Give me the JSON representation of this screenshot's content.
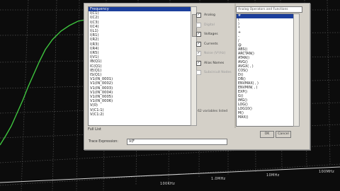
{
  "plot": {
    "x_tick_labels": [
      "100KHz",
      "1.0MHz",
      "10MHz",
      "100MHz"
    ],
    "trace_color": "#3ec43e",
    "grid_color": "#4a4a4a"
  },
  "dialog": {
    "variables_header": "Frequency",
    "variables": [
      "I(C1)",
      "I(C2)",
      "I(C3)",
      "I(C4)",
      "I(L1)",
      "I(R1)",
      "I(R2)",
      "I(R3)",
      "I(R4)",
      "I(R5)",
      "I(V1)",
      "IB(Q1)",
      "IC(Q1)",
      "IE(Q1)",
      "IS(Q1)",
      "V1(IN_0001)",
      "V1(IN_0002)",
      "V1(IN_0003)",
      "V1(IN_0004)",
      "V1(IN_0005)",
      "V1(IN_0006)",
      "V(0)",
      "V(C1:1)",
      "V(C1:2)"
    ],
    "filters": [
      {
        "label": "Analog",
        "checked": true,
        "enabled": true
      },
      {
        "label": "Digital",
        "checked": false,
        "enabled": false
      },
      {
        "label": "Voltages",
        "checked": true,
        "enabled": true
      },
      {
        "label": "Currents",
        "checked": true,
        "enabled": true
      },
      {
        "label": "Noise (V²/Hz)",
        "checked": true,
        "enabled": false
      },
      {
        "label": "Alias Names",
        "checked": true,
        "enabled": true
      },
      {
        "label": "Subcircuit Nodes",
        "checked": false,
        "enabled": false
      }
    ],
    "variable_count": "62 variables listed",
    "functions_dropdown": "Analog Operators and Functions",
    "functions": [
      "#",
      "(",
      ")",
      "*",
      "+",
      "-",
      "/",
      "@",
      "ABS()",
      "ARCTAN()",
      "ATAN()",
      "AVG()",
      "AVGX( , )",
      "COS()",
      "D()",
      "DB()",
      "ENVMAX( , )",
      "ENVMIN( , )",
      "EXP()",
      "G()",
      "IMG()",
      "LOG()",
      "LOG10()",
      "M()",
      "MAX()"
    ],
    "full_list_label": "Full List",
    "trace_expression_label": "Trace Expression:",
    "trace_expression_value": "V(F",
    "ok_label": "OK",
    "cancel_label": "Cancel"
  }
}
